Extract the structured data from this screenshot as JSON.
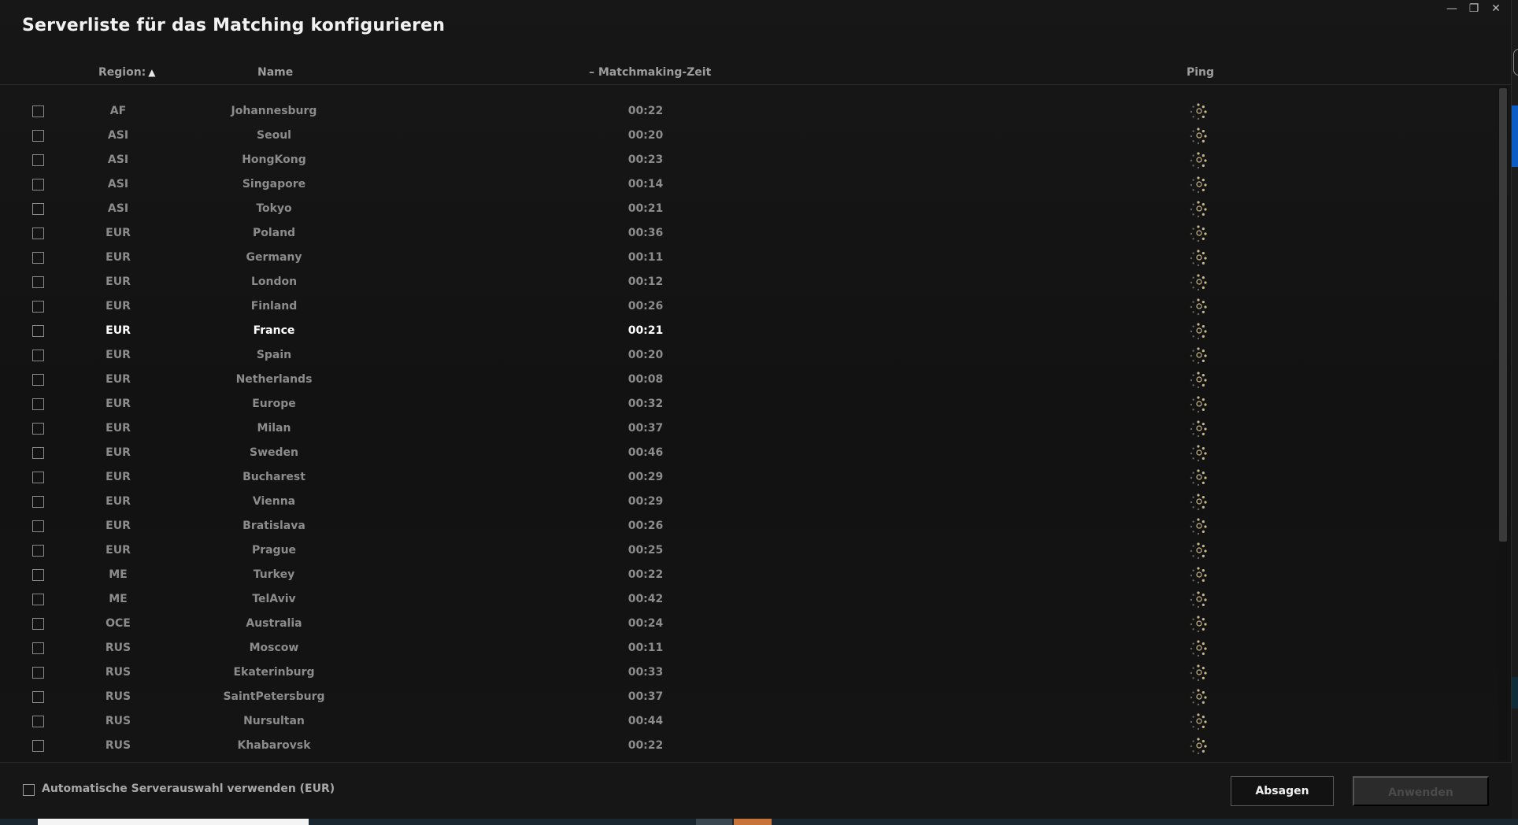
{
  "window": {
    "title": "Serverliste für das Matching konfigurieren"
  },
  "window_controls": {
    "minimize": "—",
    "restore": "❐",
    "close": "✕"
  },
  "columns": {
    "region": "Region:",
    "name": "Name",
    "matchmaking": "– Matchmaking-Zeit",
    "ping": "Ping"
  },
  "sort": {
    "column": "region",
    "direction": "ascending",
    "indicator_icon": "caret-up-icon"
  },
  "servers": [
    {
      "region": "AF",
      "name": "Johannesburg",
      "time": "00:22"
    },
    {
      "region": "ASI",
      "name": "Seoul",
      "time": "00:20"
    },
    {
      "region": "ASI",
      "name": "HongKong",
      "time": "00:23"
    },
    {
      "region": "ASI",
      "name": "Singapore",
      "time": "00:14"
    },
    {
      "region": "ASI",
      "name": "Tokyo",
      "time": "00:21"
    },
    {
      "region": "EUR",
      "name": "Poland",
      "time": "00:36"
    },
    {
      "region": "EUR",
      "name": "Germany",
      "time": "00:11"
    },
    {
      "region": "EUR",
      "name": "London",
      "time": "00:12"
    },
    {
      "region": "EUR",
      "name": "Finland",
      "time": "00:26"
    },
    {
      "region": "EUR",
      "name": "France",
      "time": "00:21",
      "active": true
    },
    {
      "region": "EUR",
      "name": "Spain",
      "time": "00:20"
    },
    {
      "region": "EUR",
      "name": "Netherlands",
      "time": "00:08"
    },
    {
      "region": "EUR",
      "name": "Europe",
      "time": "00:32"
    },
    {
      "region": "EUR",
      "name": "Milan",
      "time": "00:37"
    },
    {
      "region": "EUR",
      "name": "Sweden",
      "time": "00:46"
    },
    {
      "region": "EUR",
      "name": "Bucharest",
      "time": "00:29"
    },
    {
      "region": "EUR",
      "name": "Vienna",
      "time": "00:29"
    },
    {
      "region": "EUR",
      "name": "Bratislava",
      "time": "00:26"
    },
    {
      "region": "EUR",
      "name": "Prague",
      "time": "00:25"
    },
    {
      "region": "ME",
      "name": "Turkey",
      "time": "00:22"
    },
    {
      "region": "ME",
      "name": "TelAviv",
      "time": "00:42"
    },
    {
      "region": "OCE",
      "name": "Australia",
      "time": "00:24"
    },
    {
      "region": "RUS",
      "name": "Moscow",
      "time": "00:11"
    },
    {
      "region": "RUS",
      "name": "Ekaterinburg",
      "time": "00:33"
    },
    {
      "region": "RUS",
      "name": "SaintPetersburg",
      "time": "00:37"
    },
    {
      "region": "RUS",
      "name": "Nursultan",
      "time": "00:44"
    },
    {
      "region": "RUS",
      "name": "Khabarovsk",
      "time": "00:22"
    }
  ],
  "ping_icon": "loading-spinner-icon",
  "footer": {
    "auto_select_label": "Automatische Serverauswahl verwenden (EUR)",
    "cancel_label": "Absagen",
    "apply_label": "Anwenden"
  },
  "colors": {
    "active_text": "#ffffff",
    "inactive_text": "#8c8c8c",
    "spinner_dot": "#c9b98a",
    "spinner_dot_dim": "#6e6a5c"
  }
}
